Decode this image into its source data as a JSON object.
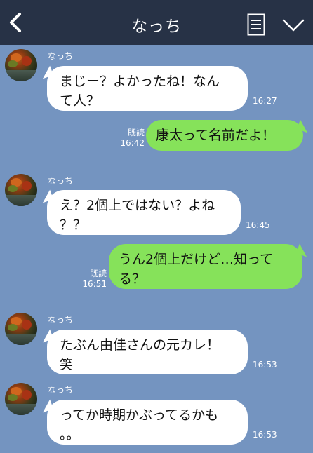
{
  "header": {
    "title": "なっち",
    "back_icon": "chevron-left-icon",
    "menu_icon": "notes-icon",
    "chevron_icon": "chevron-down-icon",
    "background": "#273246"
  },
  "chat": {
    "background": "#7494c0",
    "incoming_bubble_color": "#ffffff",
    "outgoing_bubble_color": "#86e25a",
    "messages": [
      {
        "direction": "in",
        "sender": "なっち",
        "line1": "まじー？よかったね！なん",
        "line2": "て人？",
        "time": "16:27"
      },
      {
        "direction": "out",
        "read": "既読",
        "line1": "康太って名前だよ！",
        "time": "16:42"
      },
      {
        "direction": "in",
        "sender": "なっち",
        "line1": "え？2個上ではない？よね",
        "line2": "？？",
        "time": "16:45"
      },
      {
        "direction": "out",
        "read": "既読",
        "line1": "うん2個上だけど…知って",
        "line2": "る？",
        "time": "16:51"
      },
      {
        "direction": "in",
        "sender": "なっち",
        "line1": "たぶん由佳さんの元カレ！",
        "line2": "笑",
        "time": "16:53"
      },
      {
        "direction": "in",
        "sender": "なっち",
        "line1": "ってか時期かぶってるかも",
        "line2": "。。",
        "time": "16:53"
      }
    ]
  }
}
